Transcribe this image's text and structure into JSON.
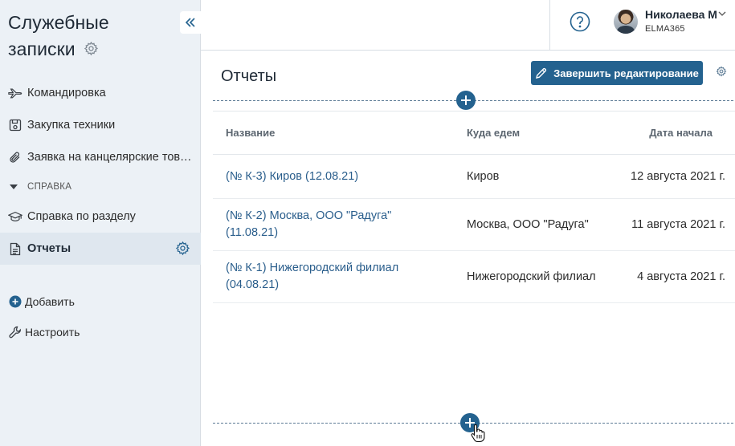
{
  "sidebar": {
    "title": "Служебные записки",
    "collapse_icon": "double-chevron-left-icon",
    "items": [
      {
        "label": "Командировка",
        "icon": "plane-icon"
      },
      {
        "label": "Закупка техники",
        "icon": "floppy-disk-icon"
      },
      {
        "label": "Заявка на канцелярские товары",
        "icon": "paperclip-icon"
      }
    ],
    "section": {
      "label": "СПРАВКА"
    },
    "section_items": [
      {
        "label": "Справка по разделу",
        "icon": "graduation-cap-icon"
      },
      {
        "label": "Отчеты",
        "icon": "document-icon",
        "active": true
      }
    ],
    "actions": {
      "add_label": "Добавить",
      "configure_label": "Настроить"
    }
  },
  "header": {
    "help_icon": "question-circle-icon",
    "user": {
      "name": "Николаева М",
      "org": "ELMA365"
    }
  },
  "main": {
    "title": "Отчеты",
    "finish_button": "Завершить редактирование",
    "table": {
      "columns": [
        "Название",
        "Куда едем",
        "Дата начала"
      ],
      "rows": [
        {
          "name": "(№ К-3) Киров (12.08.21)",
          "destination": "Киров",
          "start_date": "12 августа 2021 г."
        },
        {
          "name": "(№ К-2) Москва, ООО \"Радуга\" (11.08.21)",
          "destination": "Москва, ООО \"Радуга\"",
          "start_date": "11 августа 2021 г."
        },
        {
          "name": "(№ К-1) Нижегородский филиал (04.08.21)",
          "destination": "Нижегородский филиал",
          "start_date": "4 августа 2021 г."
        }
      ]
    }
  },
  "colors": {
    "accent": "#24628f",
    "sidebar_bg": "#ecf1f6",
    "link": "#2a5e8c"
  }
}
